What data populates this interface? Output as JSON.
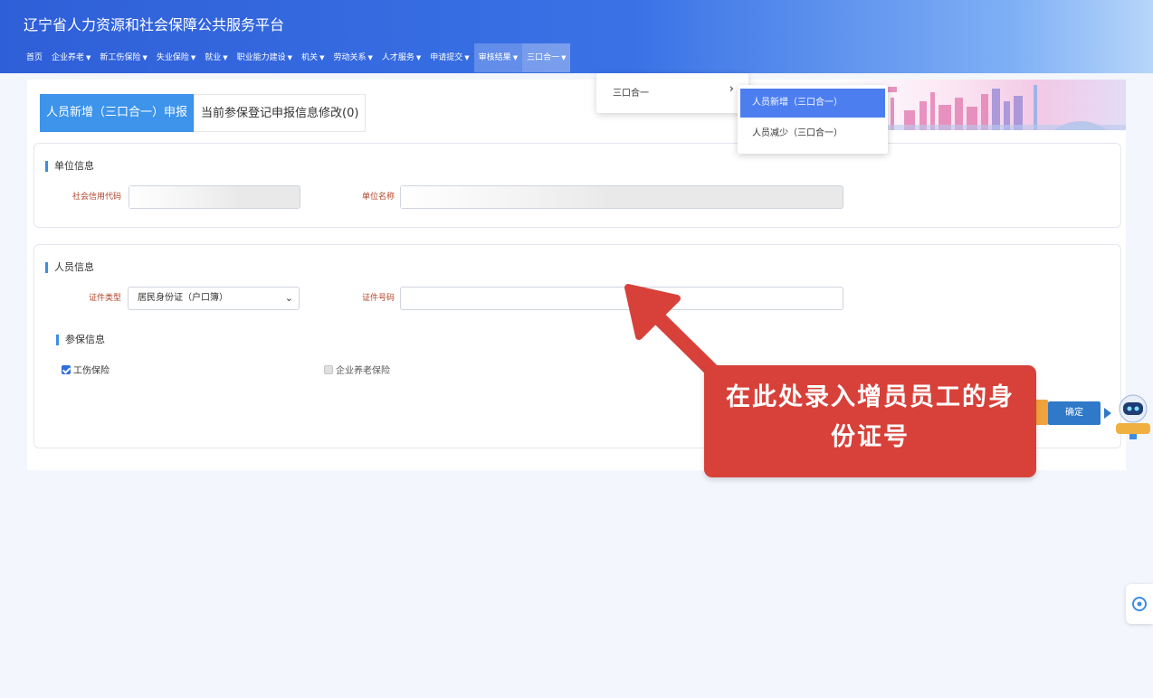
{
  "header": {
    "site_title": "辽宁省人力资源和社会保障公共服务平台"
  },
  "nav": [
    {
      "label": "首页",
      "caret": ""
    },
    {
      "label": "企业养老",
      "caret": "▼"
    },
    {
      "label": "新工伤保险",
      "caret": "▼"
    },
    {
      "label": "失业保险",
      "caret": "▼"
    },
    {
      "label": "就业",
      "caret": "▼"
    },
    {
      "label": "职业能力建设",
      "caret": "▼"
    },
    {
      "label": "机关",
      "caret": "▼"
    },
    {
      "label": "劳动关系",
      "caret": "▼"
    },
    {
      "label": "人才服务",
      "caret": "▼"
    },
    {
      "label": "申请提交",
      "caret": "▼"
    },
    {
      "label": "审核结果",
      "caret": "▼"
    },
    {
      "label": "三口合一",
      "caret": "▼"
    }
  ],
  "dropdown": {
    "item": "三口合一",
    "arrow": "›"
  },
  "submenu": {
    "items": [
      "人员新增（三口合一）",
      "人员减少（三口合一）"
    ]
  },
  "tabs": {
    "active": "人员新增（三口合一）申报",
    "inactive": "当前参保登记申报信息修改(0)"
  },
  "unit_info": {
    "title": "单位信息",
    "credit_code_label": "社会信用代码",
    "unit_name_label": "单位名称"
  },
  "person_info": {
    "title": "人员信息",
    "id_type_label": "证件类型",
    "id_type_value": "居民身份证（户口簿）",
    "id_number_label": "证件号码",
    "id_number_value": ""
  },
  "insurance_info": {
    "title": "参保信息",
    "work_injury": "工伤保险",
    "pension": "企业养老保险"
  },
  "buttons": {
    "confirm": "确定"
  },
  "annotation": {
    "text": "在此处录入增员员工的身份证号"
  },
  "colors": {
    "header_blue": "#2f5fd8",
    "tab_active": "#3d94ea",
    "submenu_highlight": "#4c7ef0",
    "callout_red": "#d7413a",
    "label_red": "#b2442a",
    "confirm_blue": "#2f79c8"
  }
}
